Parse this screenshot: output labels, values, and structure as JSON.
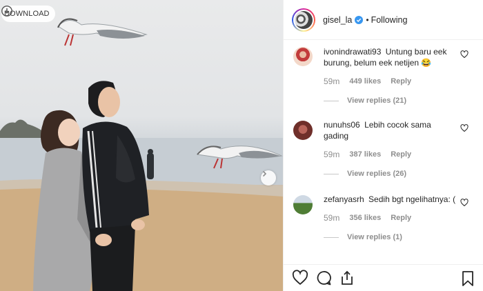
{
  "download": {
    "label": "DOWNLOAD",
    "icon": "download-icon"
  },
  "post": {
    "owner": "gisel_la",
    "separator": "•",
    "follow_status": "Following"
  },
  "comments": [
    {
      "username": "ivonindrawati93",
      "text": "Untung baru eek burung, belum eek netijen 😂",
      "age": "59m",
      "likes": "449 likes",
      "reply": "Reply",
      "view_replies": "View replies (21)"
    },
    {
      "username": "nunuhs06",
      "text": "Lebih cocok sama gading",
      "age": "59m",
      "likes": "387 likes",
      "reply": "Reply",
      "view_replies": "View replies (26)"
    },
    {
      "username": "zefanyasrh",
      "text": "Sedih bgt ngelihatnya: (",
      "age": "59m",
      "likes": "356 likes",
      "reply": "Reply",
      "view_replies": "View replies (1)"
    }
  ],
  "actions": {
    "like_icon": "heart-icon",
    "comment_icon": "comment-icon",
    "share_icon": "share-icon",
    "save_icon": "bookmark-icon"
  },
  "colors": {
    "text": "#262626",
    "secondary": "#8e8e8e",
    "verified": "#3897f0",
    "border": "#efefef"
  }
}
